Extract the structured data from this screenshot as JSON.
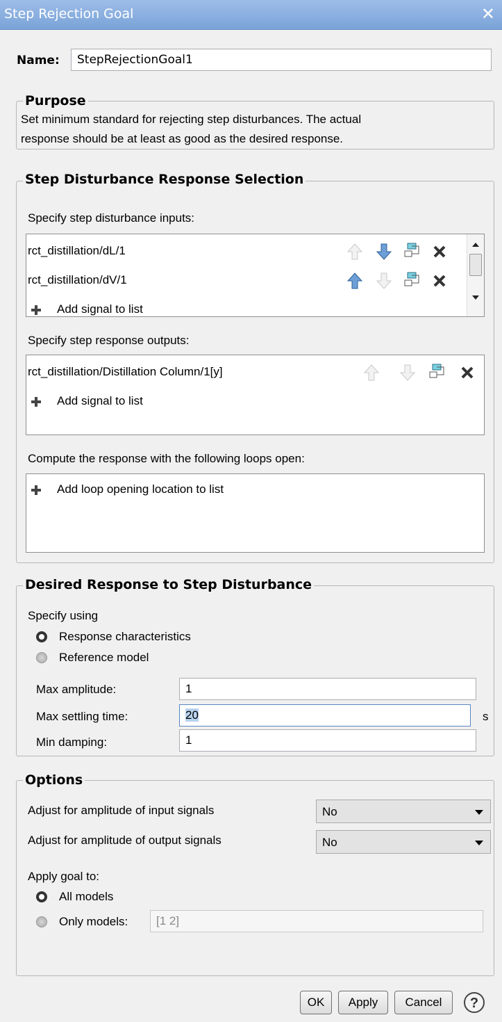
{
  "window": {
    "title": "Step Rejection Goal",
    "close_icon": "close-icon"
  },
  "name_field": {
    "label": "Name:",
    "value": "StepRejectionGoal1"
  },
  "purpose": {
    "legend": "Purpose",
    "line1": "Set minimum standard for rejecting step disturbances. The actual",
    "line2": "response should be at least as good as the desired response."
  },
  "selection": {
    "legend": "Step Disturbance Response Selection",
    "inputs_label": "Specify step disturbance inputs:",
    "inputs": [
      "rct_distillation/dL/1",
      "rct_distillation/dV/1"
    ],
    "add_signal": "Add signal to list",
    "outputs_label": "Specify step response outputs:",
    "outputs": [
      "rct_distillation/Distillation Column/1[y]"
    ],
    "loops_label": "Compute the response with the following loops open:",
    "add_loop": "Add loop opening location to list"
  },
  "desired": {
    "legend": "Desired Response to Step Disturbance",
    "specify_using": "Specify using",
    "radio_characteristics": "Response characteristics",
    "radio_reference": "Reference model",
    "selected": "Response characteristics",
    "max_amplitude_label": "Max amplitude:",
    "max_amplitude": "1",
    "max_settling_label": "Max settling time:",
    "max_settling": "20",
    "settling_unit": "s",
    "min_damping_label": "Min damping:",
    "min_damping": "1"
  },
  "options": {
    "legend": "Options",
    "input_adjust_label": "Adjust for amplitude of input signals",
    "input_adjust_value": "No",
    "output_adjust_label": "Adjust for amplitude of output signals",
    "output_adjust_value": "No",
    "apply_label": "Apply goal to:",
    "all_models": "All models",
    "only_models": "Only models:",
    "only_models_placeholder": "[1 2]",
    "selected": "All models"
  },
  "buttons": {
    "ok": "OK",
    "apply": "Apply",
    "cancel": "Cancel",
    "help_icon": "help-icon"
  }
}
